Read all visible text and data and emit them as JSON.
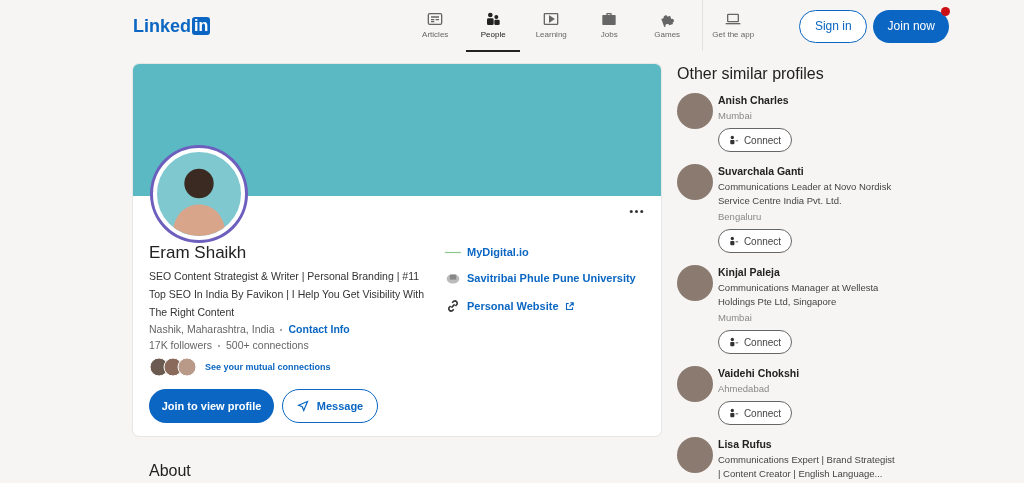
{
  "header": {
    "logo_text": "Linked",
    "logo_badge": "in",
    "nav": [
      {
        "label": "Articles",
        "kind": "article",
        "selected": false
      },
      {
        "label": "People",
        "kind": "people",
        "selected": true
      },
      {
        "label": "Learning",
        "kind": "video",
        "selected": false
      },
      {
        "label": "Jobs",
        "kind": "briefcase",
        "selected": false
      },
      {
        "label": "Games",
        "kind": "puzzle",
        "selected": false
      },
      {
        "label": "Get the app",
        "kind": "laptop",
        "selected": false
      }
    ],
    "sign_in": "Sign in",
    "join_now": "Join now",
    "notification": true
  },
  "profile": {
    "name": "Eram Shaikh",
    "headline": "SEO Content Strategist & Writer | Personal Branding | #11 Top SEO In India By Favikon | I Help You Get Visibility With The Right Content",
    "location": "Nashik, Maharashtra, India",
    "contact_link": "Contact Info",
    "followers": "17K followers",
    "connections": "500+ connections",
    "mutual_link": "See your mutual connections",
    "primary_button": "Join to view profile",
    "message_button": "Message",
    "links": [
      {
        "kind": "company",
        "label": "MyDigital.io"
      },
      {
        "kind": "school",
        "label": "Savitribai Phule Pune University"
      },
      {
        "kind": "website",
        "label": "Personal Website"
      }
    ]
  },
  "about": {
    "heading": "About"
  },
  "similar": {
    "title": "Other similar profiles",
    "people": [
      {
        "name": "Anish Charles",
        "location": "Mumbai",
        "connect": "Connect"
      },
      {
        "name": "Suvarchala Ganti",
        "headline": "Communications Leader at Novo Nordisk Service Centre India Pvt. Ltd.",
        "location": "Bengaluru",
        "connect": "Connect"
      },
      {
        "name": "Kinjal Paleja",
        "headline": "Communications Manager at Wellesta Holdings Pte Ltd, Singapore",
        "location": "Mumbai",
        "connect": "Connect"
      },
      {
        "name": "Vaidehi Chokshi",
        "location": "Ahmedabad",
        "connect": "Connect"
      },
      {
        "name": "Lisa Rufus",
        "headline": "Communications Expert | Brand Strategist | Content Creator | English Language..."
      }
    ]
  }
}
